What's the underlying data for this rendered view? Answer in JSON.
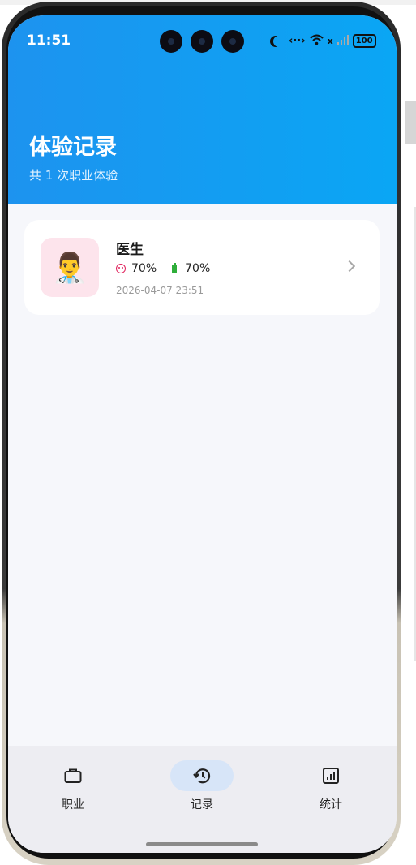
{
  "status_bar": {
    "time": "11:51",
    "signal_mark": "x",
    "battery": "100",
    "icons": [
      "moon-icon",
      "data-transfer-icon",
      "wifi-icon",
      "signal-icon",
      "battery-icon"
    ]
  },
  "header": {
    "title": "体验记录",
    "subtitle": "共 1 次职业体验",
    "gradient_colors": [
      "#1d93ef",
      "#0aa6f4"
    ]
  },
  "records": [
    {
      "avatar_emoji": "👨‍⚕️",
      "title": "医生",
      "mood_value": "70%",
      "energy_value": "70%",
      "date": "2026-04-07 23:51",
      "mood_color": "#e0245e",
      "energy_color": "#2fae3a"
    }
  ],
  "tabbar": {
    "tabs": [
      {
        "label": "职业",
        "icon": "briefcase-icon",
        "active": false
      },
      {
        "label": "记录",
        "icon": "history-icon",
        "active": true
      },
      {
        "label": "统计",
        "icon": "chart-icon",
        "active": false
      }
    ],
    "active_color": "#d7e5f8"
  }
}
